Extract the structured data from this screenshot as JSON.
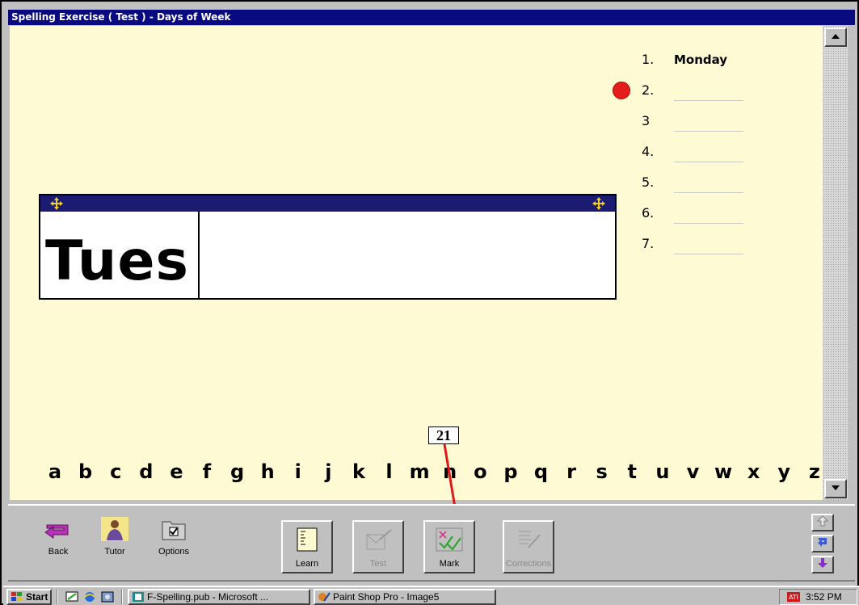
{
  "window": {
    "title": "Spelling Exercise ( Test ) - Days of Week"
  },
  "list": {
    "items": [
      {
        "number": "1.",
        "word": "Monday"
      },
      {
        "number": "2.",
        "word": ""
      },
      {
        "number": "3",
        "word": ""
      },
      {
        "number": "4.",
        "word": ""
      },
      {
        "number": "5.",
        "word": ""
      },
      {
        "number": "6.",
        "word": ""
      },
      {
        "number": "7.",
        "word": ""
      }
    ],
    "current_item": "2."
  },
  "word_box": {
    "typed": "Tues",
    "hint": ""
  },
  "alphabet": [
    "a",
    "b",
    "c",
    "d",
    "e",
    "f",
    "g",
    "h",
    "i",
    "j",
    "k",
    "l",
    "m",
    "n",
    "o",
    "p",
    "q",
    "r",
    "s",
    "t",
    "u",
    "v",
    "w",
    "x",
    "y",
    "z"
  ],
  "annotation": {
    "label": "21"
  },
  "toolbar": {
    "back_label": "Back",
    "tutor_label": "Tutor",
    "options_label": "Options",
    "learn_label": "Learn",
    "test_label": "Test",
    "mark_label": "Mark",
    "corrections_label": "Corrections"
  },
  "taskbar": {
    "start_label": "Start",
    "task1": "F-Spelling.pub - Microsoft ...",
    "task2": "Paint Shop Pro - Image5",
    "clock": "3:52 PM"
  },
  "colors": {
    "content_bg": "#fefad4",
    "title_bg": "#0a0a80",
    "word_bar": "#1c1b72",
    "marker_red": "#e51c1c"
  }
}
